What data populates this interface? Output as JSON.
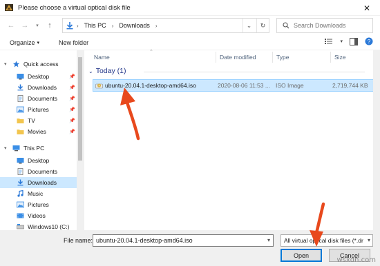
{
  "window": {
    "title": "Please choose a virtual optical disk file",
    "close_glyph": "✕"
  },
  "address_bar": {
    "path": [
      "This PC",
      "Downloads"
    ],
    "chevron": "›"
  },
  "search": {
    "placeholder": "Search Downloads"
  },
  "toolbar": {
    "organize_label": "Organize",
    "organize_caret": "▾",
    "new_folder_label": "New folder"
  },
  "sidebar": {
    "quick_access": {
      "label": "Quick access",
      "items": [
        {
          "label": "Desktop",
          "icon": "desktop-icon",
          "pinned": true
        },
        {
          "label": "Downloads",
          "icon": "downloads-icon",
          "pinned": true
        },
        {
          "label": "Documents",
          "icon": "documents-icon",
          "pinned": true
        },
        {
          "label": "Pictures",
          "icon": "pictures-icon",
          "pinned": true
        },
        {
          "label": "TV",
          "icon": "folder-icon",
          "pinned": true
        },
        {
          "label": "Movies",
          "icon": "folder-icon",
          "pinned": true
        }
      ]
    },
    "this_pc": {
      "label": "This PC",
      "items": [
        {
          "label": "Desktop",
          "icon": "desktop-icon"
        },
        {
          "label": "Documents",
          "icon": "documents-icon"
        },
        {
          "label": "Downloads",
          "icon": "downloads-icon",
          "selected": true
        },
        {
          "label": "Music",
          "icon": "music-icon"
        },
        {
          "label": "Pictures",
          "icon": "pictures-icon"
        },
        {
          "label": "Videos",
          "icon": "videos-icon"
        },
        {
          "label": "Windows10 (C:)",
          "icon": "drive-icon"
        }
      ]
    }
  },
  "file_list": {
    "columns": [
      "Name",
      "Date modified",
      "Type",
      "Size"
    ],
    "groups": [
      {
        "label": "Today (1)",
        "files": [
          {
            "name": "ubuntu-20.04.1-desktop-amd64.iso",
            "date_modified": "2020-08-06 11:53 ...",
            "type": "ISO Image",
            "size": "2,719,744 KB",
            "selected": true
          }
        ]
      }
    ]
  },
  "footer": {
    "file_name_label": "File name:",
    "file_name_value": "ubuntu-20.04.1-desktop-amd64.iso",
    "filter_value": "All virtual optical disk files (*.dr",
    "open_label": "Open",
    "cancel_label": "Cancel"
  },
  "watermark": "wsxdn.com",
  "colors": {
    "selection": "#cce8ff",
    "selection_border": "#99d1ff",
    "group_header": "#1e3287",
    "arrow": "#e8491d",
    "accent": "#0078d7"
  }
}
